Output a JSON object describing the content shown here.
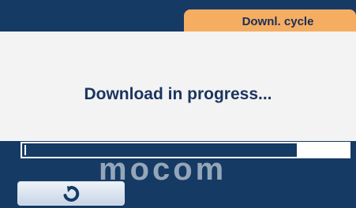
{
  "tab": {
    "label": "Downl. cycle"
  },
  "message": "Download in progress...",
  "progress": {
    "remaining_fraction": 0.16
  },
  "watermark": "mocom",
  "buttons": {
    "back_icon": "refresh-return-icon"
  },
  "colors": {
    "dark_blue": "#153a64",
    "tab_orange": "#f5ad62",
    "text_blue": "#1b3560",
    "button_light": "#eef3f9"
  }
}
